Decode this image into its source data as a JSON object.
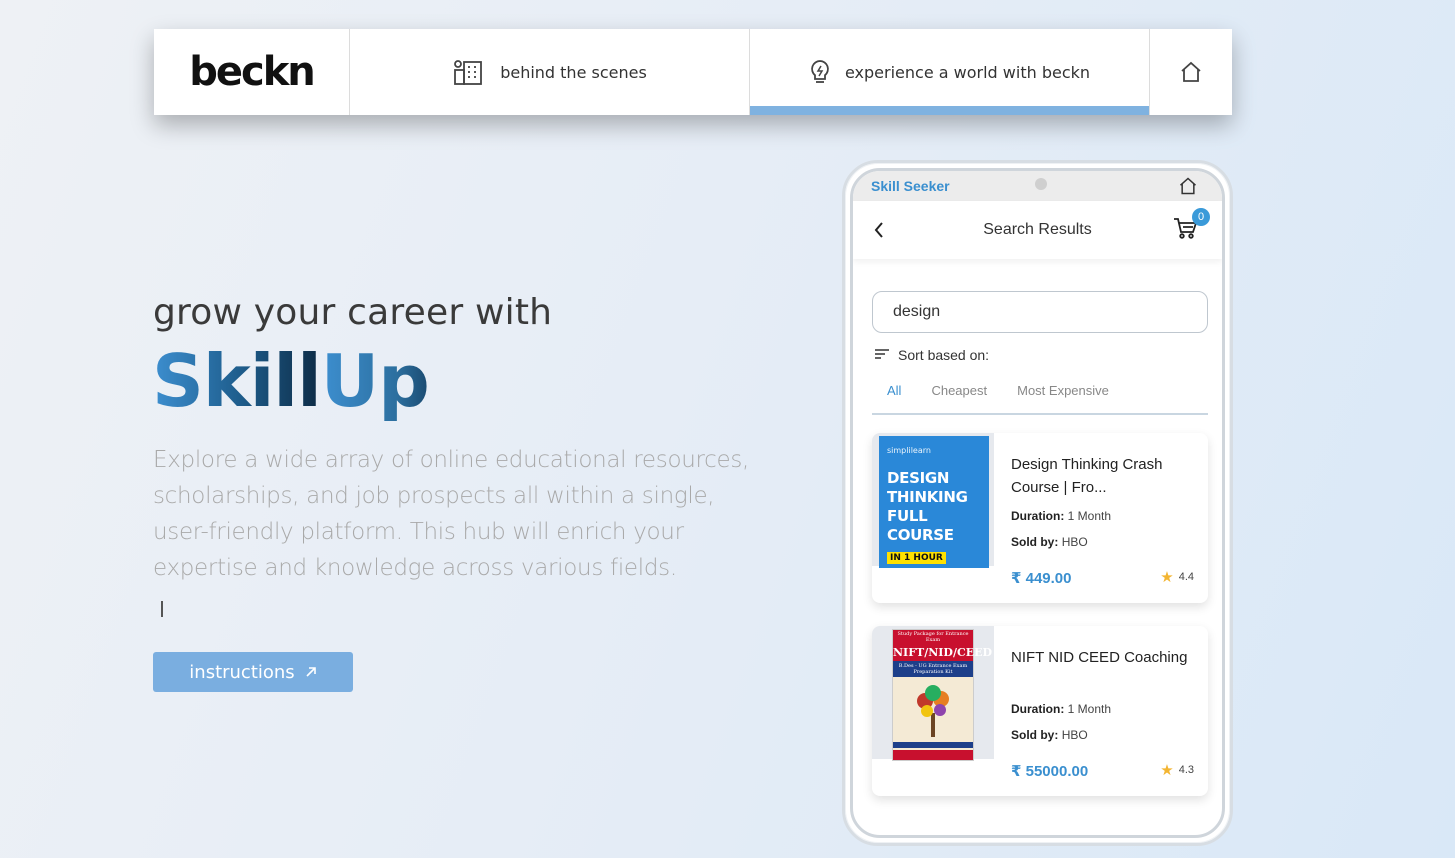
{
  "nav": {
    "logo": "beckn",
    "behind_label": "behind the scenes",
    "experience_label": "experience a world with beckn",
    "home_icon": "home-icon",
    "behind_icon": "building-icon",
    "experience_icon": "lightbulb-icon",
    "active_color": "#7fb2e0"
  },
  "hero": {
    "subtitle": "grow your career with",
    "title_part1": "Skill",
    "title_part2": "Up",
    "description": "Explore a wide array of online educational resources, scholarships, and job prospects all within a single, user-friendly platform. This hub will enrich your expertise and knowledge across various fields.",
    "button_label": "instructions",
    "button_icon": "arrow-up-right-icon",
    "button_color": "#7aaee0"
  },
  "phone": {
    "app_name": "Skill Seeker",
    "header_title": "Search Results",
    "cart_count": "0",
    "search_value": "design",
    "sort_label": "Sort based on:",
    "tabs": [
      "All",
      "Cheapest",
      "Most Expensive"
    ],
    "active_tab": "All",
    "accent_color": "#3a8fcf",
    "results": [
      {
        "title": "Design Thinking Crash Course | Fro...",
        "duration_label": "Duration:",
        "duration": "1 Month",
        "sold_by_label": "Sold by:",
        "sold_by": "HBO",
        "price": "₹ 449.00",
        "rating": "4.4",
        "thumb": {
          "brand": "simplilearn",
          "line1": "DESIGN",
          "line2": "THINKING",
          "line3": "FULL COURSE",
          "tag": "IN 1 HOUR"
        }
      },
      {
        "title": "NIFT NID CEED Coaching",
        "duration_label": "Duration:",
        "duration": "1 Month",
        "sold_by_label": "Sold by:",
        "sold_by": "HBO",
        "price": "₹ 55000.00",
        "rating": "4.3",
        "thumb": {
          "top": "Study Package for Entrance Exam",
          "title": "NIFT/NID/CEED",
          "sub": "B.Des - UG Entrance Exam Preparation Kit"
        }
      }
    ]
  }
}
